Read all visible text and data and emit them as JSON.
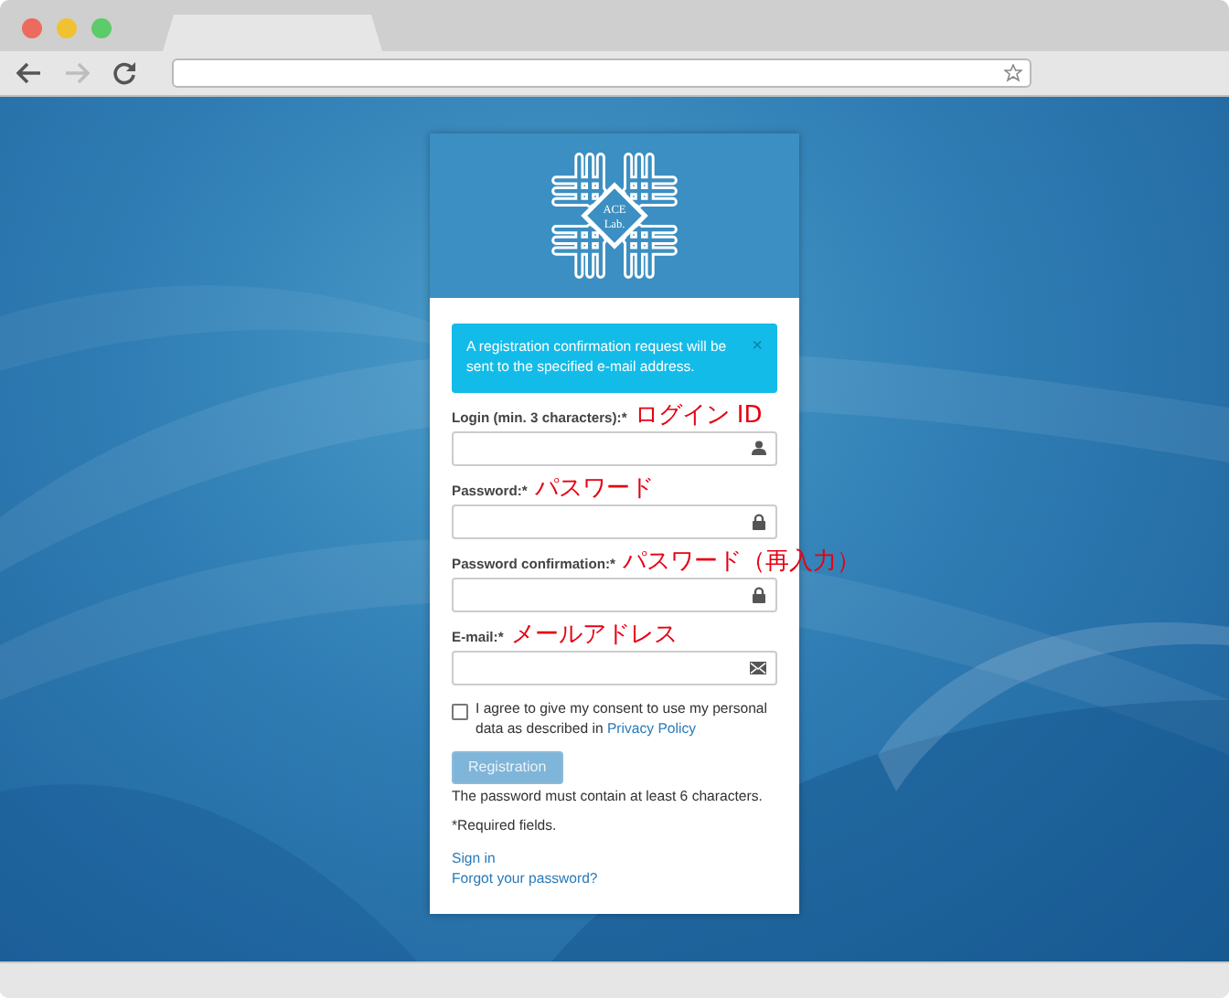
{
  "browser": {
    "nav_buttons": [
      {
        "kind": "back",
        "disabled": false
      },
      {
        "kind": "forward",
        "disabled": true
      },
      {
        "kind": "reload",
        "disabled": false
      }
    ]
  },
  "logo": {
    "line1": "ACE",
    "line2": "Lab."
  },
  "alert": {
    "text": "A registration confirmation request will be sent to the specified e-mail address.",
    "close": "×"
  },
  "fields": [
    {
      "label": "Login (min. 3 characters):*",
      "note": "ログイン ID",
      "kind": "user"
    },
    {
      "label": "Password:*",
      "note": "パスワード",
      "kind": "lock"
    },
    {
      "label": "Password confirmation:*",
      "note": "パスワード（再入力）",
      "kind": "lock"
    },
    {
      "label": "E-mail:*",
      "note": "メールアドレス",
      "kind": "envelope"
    }
  ],
  "consent": {
    "checked": false,
    "text": "I agree to give my consent to use my personal data as described in",
    "link": "Privacy Policy"
  },
  "register_button": {
    "label": "Registration",
    "disabled": true
  },
  "hints": [
    "The password must contain at least 6 characters.",
    "*Required fields."
  ],
  "links": [
    "Sign in",
    "Forgot your password?"
  ]
}
